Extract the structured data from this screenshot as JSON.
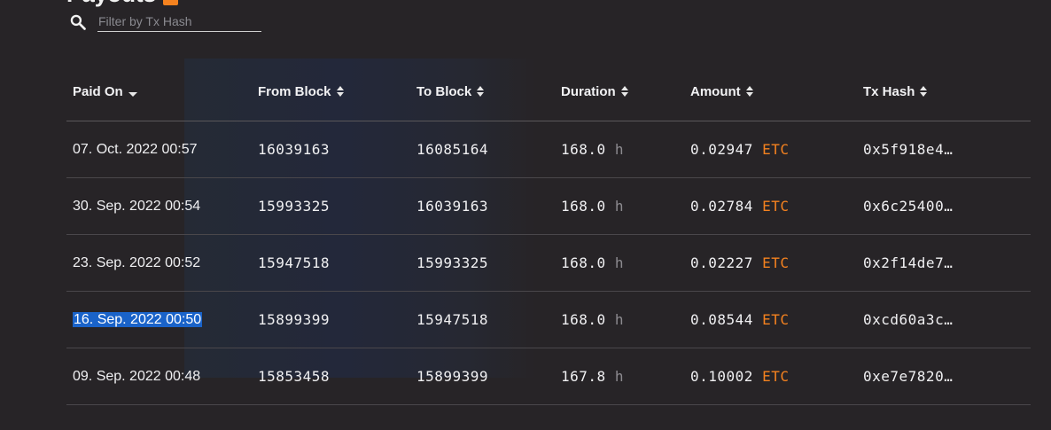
{
  "header": {
    "title": "Payouts"
  },
  "search": {
    "placeholder": "Filter by Tx Hash"
  },
  "columns": {
    "paid_on": "Paid On",
    "from_block": "From Block",
    "to_block": "To Block",
    "duration": "Duration",
    "amount": "Amount",
    "tx_hash": "Tx Hash"
  },
  "rows": [
    {
      "paid_on": "07. Oct. 2022 00:57",
      "from_block": "16039163",
      "to_block": "16085164",
      "duration": "168.0",
      "duration_unit": "h",
      "amount": "0.02947",
      "currency": "ETC",
      "tx_hash": "0x5f918e4…"
    },
    {
      "paid_on": "30. Sep. 2022 00:54",
      "from_block": "15993325",
      "to_block": "16039163",
      "duration": "168.0",
      "duration_unit": "h",
      "amount": "0.02784",
      "currency": "ETC",
      "tx_hash": "0x6c25400…"
    },
    {
      "paid_on": "23. Sep. 2022 00:52",
      "from_block": "15947518",
      "to_block": "15993325",
      "duration": "168.0",
      "duration_unit": "h",
      "amount": "0.02227",
      "currency": "ETC",
      "tx_hash": "0x2f14de7…"
    },
    {
      "paid_on": "16. Sep. 2022 00:50",
      "from_block": "15899399",
      "to_block": "15947518",
      "duration": "168.0",
      "duration_unit": "h",
      "amount": "0.08544",
      "currency": "ETC",
      "tx_hash": "0xcd60a3c…"
    },
    {
      "paid_on": "09. Sep. 2022 00:48",
      "from_block": "15853458",
      "to_block": "15899399",
      "duration": "167.8",
      "duration_unit": "h",
      "amount": "0.10002",
      "currency": "ETC",
      "tx_hash": "0xe7e7820…"
    }
  ],
  "colors": {
    "accent": "#f5821f",
    "background": "#272427",
    "selection": "#1a63c9"
  }
}
